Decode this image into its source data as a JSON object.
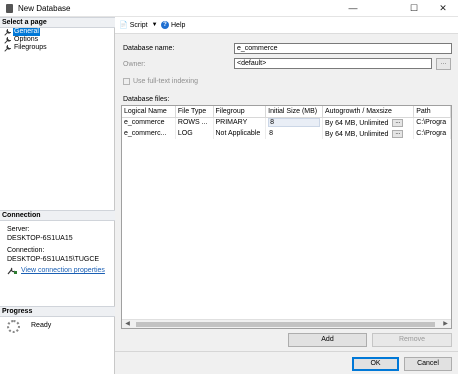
{
  "window": {
    "title": "New Database",
    "controls": {
      "minimize": "—",
      "maximize": "☐",
      "close": "✕"
    }
  },
  "left_panel": {
    "select_page_header": "Select a page",
    "pages": [
      {
        "label": "General",
        "selected": true
      },
      {
        "label": "Options",
        "selected": false
      },
      {
        "label": "Filegroups",
        "selected": false
      }
    ],
    "connection": {
      "header": "Connection",
      "server_label": "Server:",
      "server_value": "DESKTOP-6S1UA15",
      "connection_label": "Connection:",
      "connection_value": "DESKTOP-6S1UA15\\TUGCE",
      "view_link": "View connection properties"
    },
    "progress": {
      "header": "Progress",
      "status": "Ready"
    }
  },
  "toolbar": {
    "script_label": "Script",
    "help_label": "Help"
  },
  "form": {
    "db_name_label": "Database name:",
    "db_name_value": "e_commerce",
    "owner_label": "Owner:",
    "owner_value": "<default>",
    "browse_label": "...",
    "fulltext_label": "Use full-text indexing",
    "db_files_label": "Database files:"
  },
  "files_table": {
    "columns": [
      "Logical Name",
      "File Type",
      "Filegroup",
      "Initial Size (MB)",
      "Autogrowth / Maxsize",
      "Path"
    ],
    "rows": [
      [
        "e_commerce",
        "ROWS ...",
        "PRIMARY",
        "8",
        "By 64 MB, Unlimited",
        "C:\\Progra"
      ],
      [
        "e_commerc...",
        "LOG",
        "Not Applicable",
        "8",
        "By 64 MB, Unlimited",
        "C:\\Progra"
      ]
    ],
    "cell_button": "..."
  },
  "buttons": {
    "add": "Add",
    "remove": "Remove",
    "ok": "OK",
    "cancel": "Cancel"
  }
}
